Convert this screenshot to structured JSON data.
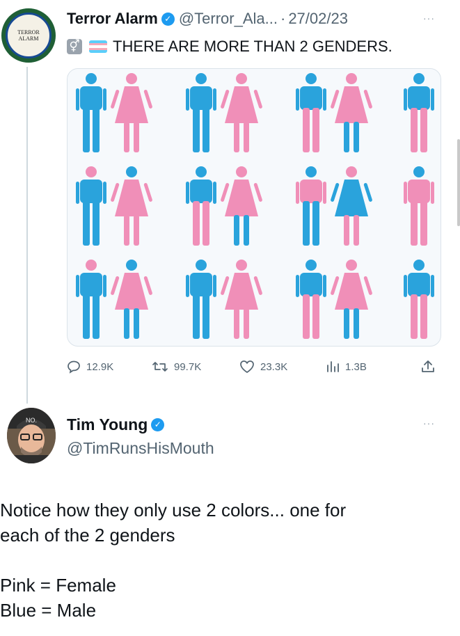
{
  "tweet": {
    "author_name": "Terror Alarm",
    "author_handle": "@Terror_Ala...",
    "separator": "·",
    "date": "27/02/23",
    "more_label": "···",
    "text": "THERE ARE MORE THAN 2 GENDERS.",
    "emojis": [
      "male-female-sign-emoji",
      "transgender-flag-emoji"
    ],
    "avatar_logo": {
      "top_arc": "TERROR ALARM",
      "center_line1": "TERROR",
      "center_line2": "ALARM",
      "bottom_arc": "www.TerrorAlarm.org"
    },
    "image": {
      "description_icons": "grid of 18 person pictograms colored pink and blue",
      "colors": {
        "pink": "#f08fb8",
        "blue": "#2aa3dc"
      }
    },
    "stats": {
      "replies": "12.9K",
      "retweets": "99.7K",
      "likes": "23.3K",
      "views": "1.3B"
    },
    "icons": {
      "reply": "reply-icon",
      "retweet": "retweet-icon",
      "like": "heart-icon",
      "views": "views-icon",
      "share": "share-icon"
    }
  },
  "reply": {
    "author_name": "Tim Young",
    "author_handle": "@TimRunsHisMouth",
    "more_label": "···",
    "lines": [
      "Notice how they only use 2 colors... one for",
      "each of the 2 genders",
      "",
      "Pink = Female",
      "Blue = Male"
    ]
  },
  "colors": {
    "verified": "#1d9bf0",
    "text": "#0f1419",
    "muted": "#536471"
  }
}
